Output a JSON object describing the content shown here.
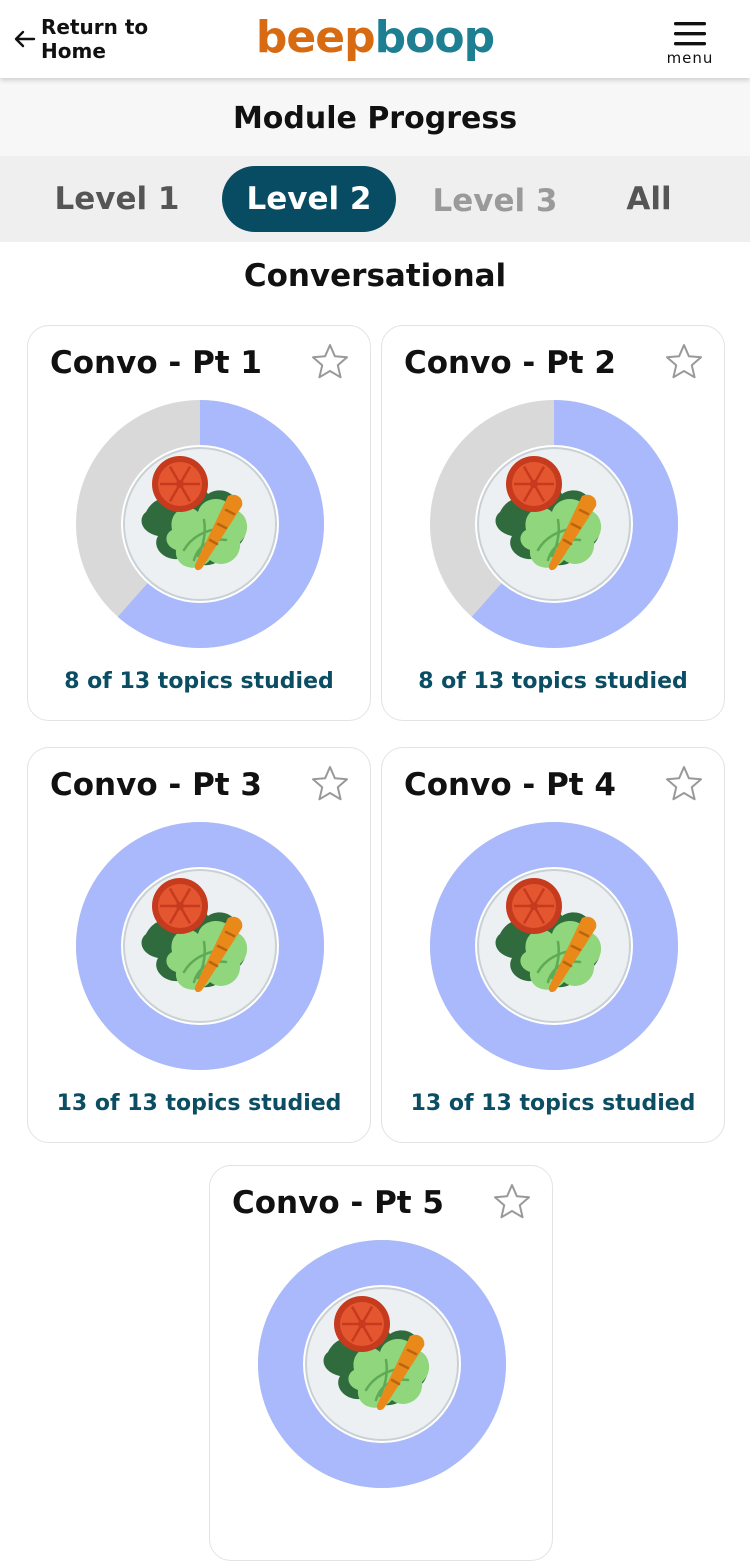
{
  "header": {
    "back_label": "Return to Home",
    "logo_part1": "beep",
    "logo_part2": "boop",
    "menu_label": "menu"
  },
  "page_title": "Module Progress",
  "tabs": [
    {
      "label": "Level 1",
      "state": "inactive"
    },
    {
      "label": "Level 2",
      "state": "active"
    },
    {
      "label": "Level 3",
      "state": "disabled"
    },
    {
      "label": "All",
      "state": "inactive"
    }
  ],
  "section_title": "Conversational",
  "cards": [
    {
      "title": "Convo - Pt 1",
      "status": "8 of 13 topics studied",
      "studied": 8,
      "total": 13
    },
    {
      "title": "Convo - Pt 2",
      "status": "8 of 13 topics studied",
      "studied": 8,
      "total": 13
    },
    {
      "title": "Convo - Pt 3",
      "status": "13 of 13 topics studied",
      "studied": 13,
      "total": 13
    },
    {
      "title": "Convo - Pt 4",
      "status": "13 of 13 topics studied",
      "studied": 13,
      "total": 13
    },
    {
      "title": "Convo - Pt 5",
      "status": "",
      "studied": 13,
      "total": 13
    }
  ],
  "colors": {
    "progress": "#aab9fb",
    "remaining": "#d9d9d9",
    "accent_dark": "#074c63",
    "logo_orange": "#d86a12",
    "logo_teal": "#1e7f92"
  },
  "icons": {
    "back": "arrow-left-icon",
    "menu": "hamburger-menu-icon",
    "favorite": "star-outline-icon",
    "module": "salad-plate-icon"
  }
}
